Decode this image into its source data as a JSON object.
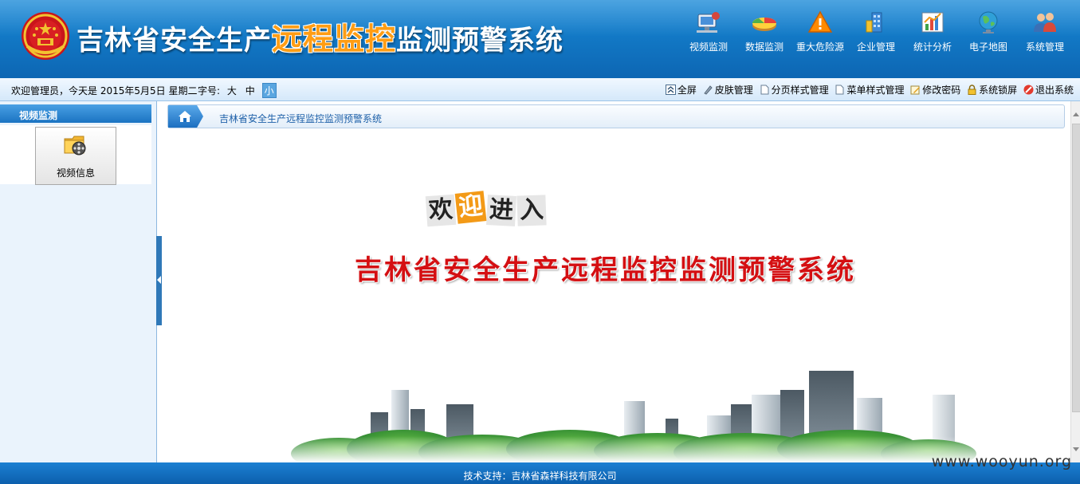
{
  "header": {
    "title_before": "吉林省安全生产",
    "title_highlight": "远程监控",
    "title_after": "监测预警系统",
    "nav": [
      {
        "label": "视频监测",
        "icon": "video-monitor-icon"
      },
      {
        "label": "数据监测",
        "icon": "data-monitor-icon"
      },
      {
        "label": "重大危险源",
        "icon": "hazard-warning-icon"
      },
      {
        "label": "企业管理",
        "icon": "enterprise-icon"
      },
      {
        "label": "统计分析",
        "icon": "statistics-icon"
      },
      {
        "label": "电子地图",
        "icon": "map-globe-icon"
      },
      {
        "label": "系统管理",
        "icon": "users-icon"
      }
    ]
  },
  "toolbar": {
    "welcome": "欢迎管理员，今天是 2015年5月5日 星期二",
    "fontsize_label": "字号:",
    "fontsize_options": [
      "大",
      "中",
      "小"
    ],
    "fontsize_selected": "小",
    "tools": [
      {
        "label": "全屏",
        "icon": "fullscreen-icon"
      },
      {
        "label": "皮肤管理",
        "icon": "skin-icon"
      },
      {
        "label": "分页样式管理",
        "icon": "page-icon"
      },
      {
        "label": "菜单样式管理",
        "icon": "page-icon"
      },
      {
        "label": "修改密码",
        "icon": "edit-password-icon"
      },
      {
        "label": "系统锁屏",
        "icon": "lock-icon"
      },
      {
        "label": "退出系统",
        "icon": "exit-icon"
      }
    ]
  },
  "sidebar": {
    "title": "视频监测",
    "items": [
      {
        "label": "视频信息",
        "icon": "video-folder-icon"
      }
    ]
  },
  "content": {
    "breadcrumb": "吉林省安全生产远程监控监测预警系统",
    "welcome_chars": [
      "欢",
      "迎",
      "进",
      "入"
    ],
    "banner_title": "吉林省安全生产远程监控监测预警系统"
  },
  "footer": {
    "text": "技术支持：吉林省森祥科技有限公司"
  },
  "watermark": "www.wooyun.org",
  "colors": {
    "header_blue": "#1279c6",
    "title_orange": "#ff9d14",
    "banner_red": "#d40f12",
    "footer_blue": "#0c5fad"
  }
}
